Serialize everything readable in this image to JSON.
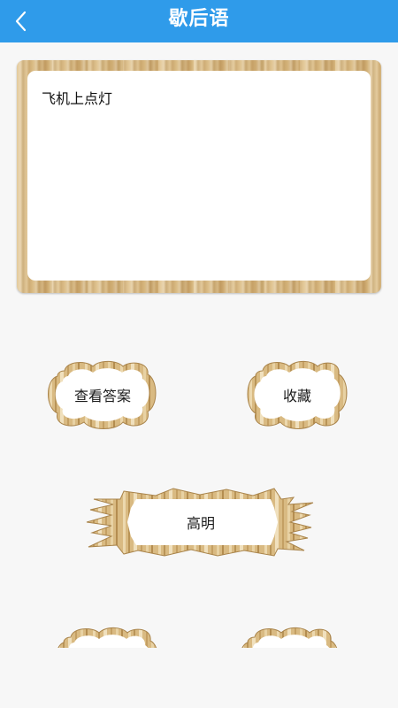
{
  "header": {
    "title": "歇后语"
  },
  "riddle": {
    "text": "飞机上点灯"
  },
  "actions": {
    "show_answer_label": "查看答案",
    "favorite_label": "收藏",
    "answer_label": "高明"
  },
  "colors": {
    "header_bg": "#2f9bea",
    "wood": "#d7b77e",
    "page_bg": "#f7f7f7"
  }
}
